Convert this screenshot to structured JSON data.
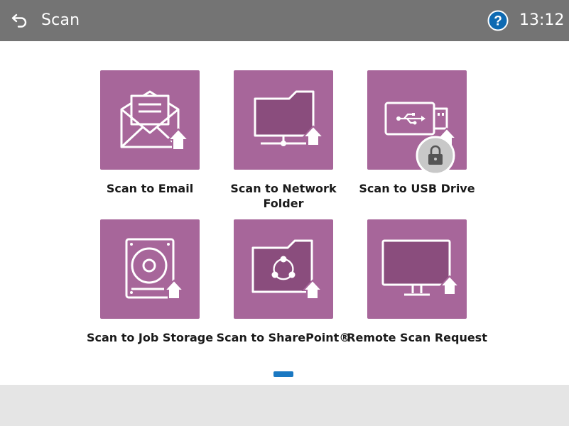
{
  "header": {
    "title": "Scan",
    "time": "13:12",
    "help_glyph": "?"
  },
  "tiles": [
    {
      "label": "Scan to Email",
      "icon": "envelope-upload-icon"
    },
    {
      "label": "Scan to Network Folder",
      "icon": "network-folder-upload-icon"
    },
    {
      "label": "Scan to USB Drive",
      "icon": "usb-drive-upload-icon",
      "locked": true
    },
    {
      "label": "Scan to Job Storage",
      "icon": "hard-drive-upload-icon"
    },
    {
      "label": "Scan to SharePoint®",
      "icon": "sharepoint-folder-upload-icon"
    },
    {
      "label": "Remote Scan Request",
      "icon": "monitor-upload-icon"
    }
  ],
  "colors": {
    "header_bg": "#747474",
    "tile_bg": "#a7669a",
    "page_indicator": "#1a78c2",
    "footer_bg": "#e5e5e5"
  },
  "pager": {
    "current_page": 1,
    "total_pages": 1
  }
}
